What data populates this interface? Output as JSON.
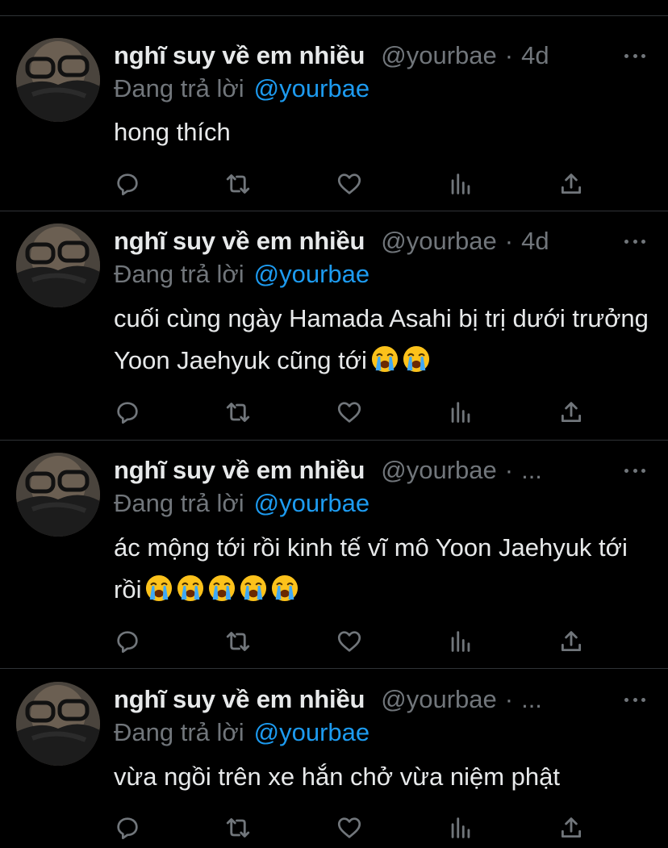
{
  "colors": {
    "background": "#000000",
    "primary_text": "#e7e9ea",
    "secondary_text": "#71767b",
    "link": "#1d9bf0",
    "divider": "#2f3336"
  },
  "action_icons": [
    "reply-icon",
    "retweet-icon",
    "like-icon",
    "views-icon",
    "share-icon"
  ],
  "tweets": [
    {
      "display_name": "nghĩ suy về em nhiều",
      "handle": "@yourbae",
      "separator": "·",
      "time": "4d",
      "reply_label": "Đang trả lời",
      "reply_to": "@yourbae",
      "text": "hong thích",
      "emoji_count": 0
    },
    {
      "display_name": "nghĩ suy về em nhiều",
      "handle": "@yourbae",
      "separator": "·",
      "time": "4d",
      "reply_label": "Đang trả lời",
      "reply_to": "@yourbae",
      "text": "cuối cùng ngày Hamada Asahi bị trị dưới trưởng Yoon Jaehyuk cũng tới",
      "emoji_count": 2
    },
    {
      "display_name": "nghĩ suy về em nhiều",
      "handle": "@yourbae",
      "separator": "·",
      "time": "...",
      "reply_label": "Đang trả lời",
      "reply_to": "@yourbae",
      "text": "ác mộng tới rồi kinh tế vĩ mô Yoon Jaehyuk tới rồi",
      "emoji_count": 5
    },
    {
      "display_name": "nghĩ suy về em nhiều",
      "handle": "@yourbae",
      "separator": "·",
      "time": "...",
      "reply_label": "Đang trả lời",
      "reply_to": "@yourbae",
      "text": "vừa ngồi trên xe hắn chở vừa niệm phật",
      "emoji_count": 0
    }
  ]
}
